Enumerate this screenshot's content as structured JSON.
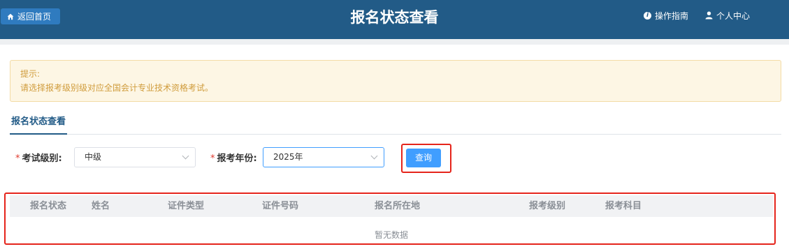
{
  "header": {
    "back_label": "返回首页",
    "title": "报名状态查看",
    "guide_label": "操作指南",
    "user_label": "个人中心",
    "bg_color": "#225b87"
  },
  "notice": {
    "title": "提示:",
    "text": "请选择报考级别级对应全国会计专业技术资格考试。"
  },
  "tab": {
    "label": "报名状态查看"
  },
  "form": {
    "level_label": "考试级别:",
    "level_value": "中级",
    "year_label": "报考年份:",
    "year_value": "2025年",
    "required_mark": "*",
    "query_label": "查询"
  },
  "table": {
    "columns": [
      "报名状态",
      "姓名",
      "证件类型",
      "证件号码",
      "报名所在地",
      "报考级别",
      "报考科目"
    ],
    "empty_text": "暂无数据"
  }
}
